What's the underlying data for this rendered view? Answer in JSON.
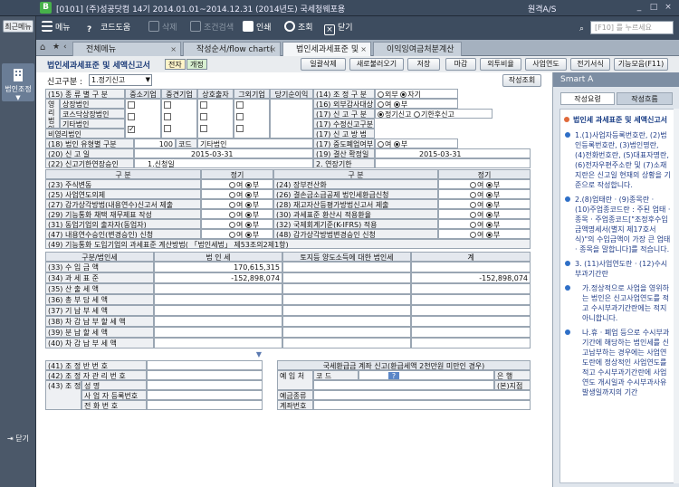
{
  "titlebar": {
    "logo": "B",
    "text": "[0101] (주)성공닷컴    14기  2014.01.01~2014.12.31 (2014년도)  국세청웨포용",
    "right": "원격A/S",
    "min": "_",
    "max": "□",
    "close": "×"
  },
  "recent": {
    "button": "최근메뉴",
    "law": "법인조정",
    "close": "닫기"
  },
  "toolbar": {
    "menu": "메뉴",
    "help": "코드도움",
    "delete": "삭제",
    "cond_search": "조건검색",
    "print": "인쇄",
    "query": "조회",
    "close": "닫기",
    "search_placeholder": "[F10] 를 누르세요"
  },
  "tabs": [
    {
      "label": "전체메뉴"
    },
    {
      "label": "작성순서/flow chart("
    },
    {
      "label": "법인세과세표준 및"
    },
    {
      "label": "이익잉여금처분계산"
    }
  ],
  "form": {
    "title": "법인세과세표준 및 세액신고서",
    "badge_prev": "전자",
    "badge_new": "개정",
    "buttons": [
      "일괄삭제",
      "새로불러오기",
      "저장",
      "마감",
      "외투비율",
      "사업연도",
      "전기서식",
      "기능모음(F11)"
    ]
  },
  "division": {
    "label": "신고구분 :",
    "value": "1.정기신고",
    "set_button": "작성조회"
  },
  "left_sec": {
    "r15": "(15) 종 류 별 구 분",
    "h_small": "중소기업",
    "h_mid": "중견기업",
    "h_mutual": "상호출자",
    "h_other": "그외기업",
    "h_total": "당기순이익",
    "listed": "영리법인",
    "listed_a": "상장법인",
    "listed_b": "코스닥상장법인",
    "listed_c": "기타법인",
    "nonprofit": "비영리법인",
    "r18": "(18) 법인 유형별 구분",
    "r18v": "100",
    "r18c": "코드",
    "r18n": "기타법인",
    "r20": "(20) 신  고  일",
    "r20v": "2015-03-31",
    "r22": "(22) 신고기한연장승인",
    "r22v": "1.신청일"
  },
  "right_sec": {
    "r14": "(14) 조 정  구 분",
    "r14a": "외부",
    "r14b": "자기",
    "r16": "(16) 외부감사대상",
    "r16a": "여",
    "r16b": "부",
    "r17": "(17) 신  고  구  분",
    "r17a": "정기신고",
    "r17b": "기한후신고",
    "r17b2": "(17) 수정신고구분",
    "r17c": "(17) 신  고  방  법",
    "r17d": "(17) 중도폐업여부",
    "r19": "(19) 결산 확정일",
    "r19v": "2015-03-31",
    "r2": "2. 연장기한"
  },
  "grid": {
    "h1": "구 분",
    "h2": "정기",
    "h3": "구 분",
    "h4": "정기",
    "rows_l": [
      "(23) 주식변동",
      "(25) 사업연도의제",
      "(27) 감가상각방법(내용연수)신고서 제출",
      "(29) 기능통화 채택 재무제표 작성",
      "(31) 동업기업의 출자자(동업자)",
      "(47) 내용연수승인(변경승인) 신청"
    ],
    "rows_r": [
      "(24) 장부전산화",
      "(26) 결손금소급공제 법인세환급신청",
      "(28) 재고자산등평가방법신고서 제출",
      "(30) 과세표준 환산시 적용환율",
      "(32) 국제회계기준(K-IFRS) 적용",
      "(48) 감가상각방법변경승인 신청"
    ],
    "yes": "여",
    "no": "부",
    "r49": "(49) 기능통화 도입기업의 과세표준 계산방법( 「법인세법」 제53조의2제1항)"
  },
  "tax": {
    "h_cat": "구분/법인세",
    "h1": "법 인 세",
    "h2": "토지등 양도소득에 대한 법인세",
    "h3": "계",
    "rows": [
      {
        "l": "(33) 수   입   금   액",
        "a": "170,615,315",
        "b": "",
        "c": ""
      },
      {
        "l": "(34) 과   세   표   준",
        "a": "-152,898,074",
        "b": "",
        "c": "-152,898,074"
      },
      {
        "l": "(35) 산   출   세   액",
        "a": "",
        "b": "",
        "c": ""
      },
      {
        "l": "(36) 총   부   담   세   액",
        "a": "",
        "b": "",
        "c": ""
      },
      {
        "l": "(37) 기   납   부   세   액",
        "a": "",
        "b": "",
        "c": ""
      },
      {
        "l": "(38) 차 감 납 부 할 세 액",
        "a": "",
        "b": "",
        "c": ""
      },
      {
        "l": "(39) 분   납   할   세   액",
        "a": "",
        "b": "",
        "c": ""
      },
      {
        "l": "(40) 차   감   납   부   세   액",
        "a": "",
        "b": "",
        "c": ""
      }
    ]
  },
  "collapse": "▼",
  "bottom": {
    "r41": "(41) 조  정  반  번  호",
    "r42": "(42) 조 정 자 관 리 번 호",
    "r43": "(43) 조 정 자",
    "r43a": "성   명",
    "r43b": "사 업 자 등록번호",
    "r43c": "전   화   번   호",
    "refund": "국세환급금 계좌 신고(환급세액 2천만원 미만인 경우)",
    "bank": "예 입 처",
    "code": "코   드",
    "bankname": "은  행",
    "branch": "(본)지점",
    "acct_type": "예금종류",
    "acct_no": "계좌번호",
    "q": "?"
  },
  "smart": {
    "header": "Smart A",
    "tab1": "작성요령",
    "tab2": "작성흐름",
    "title": "법인세 과세표준 및 세액신고서",
    "items": [
      {
        "t": "1.(1)사업자등록번호란, (2)법인등록번호란, (3)법인명란, (4)전화번호란, (5)대표자명란, (6)전자우편주소란 및 (7)소재지란은 신고일 현재의 상황을 기준으로 작성합니다."
      },
      {
        "t": "2.(8)업태란 · (9)종목란 · (10)주업종코드란 : 주된 업태 · 종목 · 주업종코드[\"조정후수입금액명세서(별지 제17호서식)\"의 수입금액이 가장 큰 업태 · 종목을 말합니다]를 적습니다."
      },
      {
        "t": "3. (11)사업연도란 · (12)수시부과기간란"
      },
      {
        "t": "가.정상적으로 사업을 영위하는 법인은 신고사업연도를 적고 수시부과기간란에는 적지 아니합니다."
      },
      {
        "t": "나.휴 · 폐업 등으로 수시부과기간에 해당하는 법인세를 신고납부하는 경우에는 사업연도란에 정상적인 사업연도를 적고 수시부과기간란에 사업연도 개시일과 수시부과사유 발생일까지의 기간"
      }
    ]
  }
}
